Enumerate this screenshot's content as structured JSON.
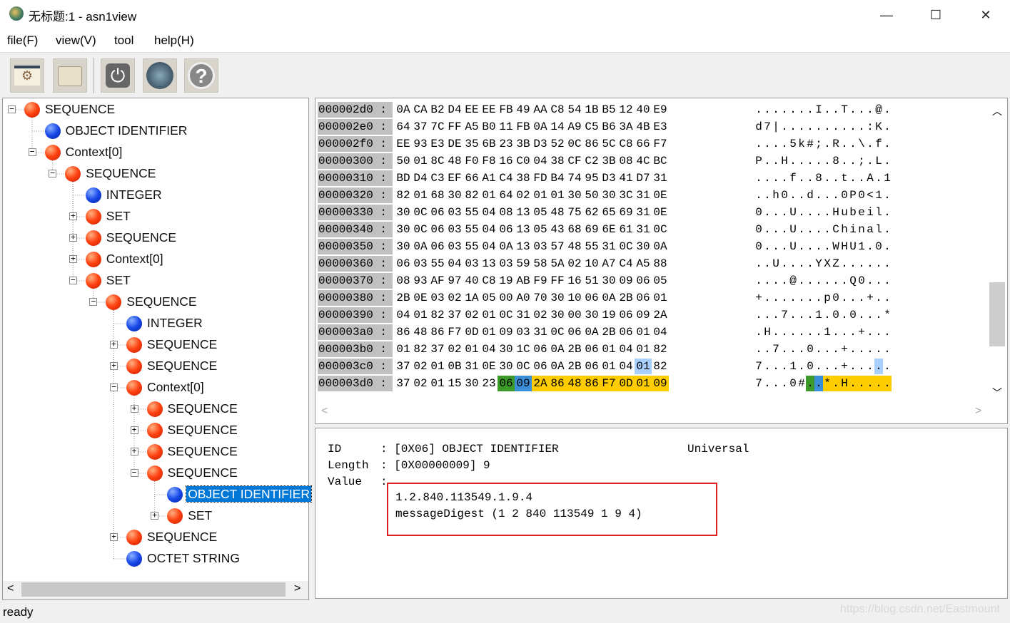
{
  "window": {
    "title": "无标题:1 - asn1view",
    "min": "—",
    "max": "☐",
    "close": "✕"
  },
  "menu": [
    "file(F)",
    "view(V)",
    "tool",
    "help(H)"
  ],
  "toolbar": [
    {
      "icon": "settings-window-icon"
    },
    {
      "icon": "folder-icon"
    },
    {
      "icon": "power-icon"
    },
    {
      "icon": "globe-image-icon"
    },
    {
      "icon": "help-icon"
    }
  ],
  "tree": [
    {
      "level": 0,
      "label": "SEQUENCE",
      "type": "red",
      "toggle": "-"
    },
    {
      "level": 1,
      "label": "OBJECT IDENTIFIER",
      "type": "blue",
      "toggle": ""
    },
    {
      "level": 1,
      "label": "Context[0]",
      "type": "red",
      "toggle": "-"
    },
    {
      "level": 2,
      "label": "SEQUENCE",
      "type": "red",
      "toggle": "-"
    },
    {
      "level": 3,
      "label": "INTEGER",
      "type": "blue",
      "toggle": ""
    },
    {
      "level": 3,
      "label": "SET",
      "type": "red",
      "toggle": "+"
    },
    {
      "level": 3,
      "label": "SEQUENCE",
      "type": "red",
      "toggle": "+"
    },
    {
      "level": 3,
      "label": "Context[0]",
      "type": "red",
      "toggle": "+"
    },
    {
      "level": 3,
      "label": "SET",
      "type": "red",
      "toggle": "-"
    },
    {
      "level": 4,
      "label": "SEQUENCE",
      "type": "red",
      "toggle": "-"
    },
    {
      "level": 5,
      "label": "INTEGER",
      "type": "blue",
      "toggle": ""
    },
    {
      "level": 5,
      "label": "SEQUENCE",
      "type": "red",
      "toggle": "+"
    },
    {
      "level": 5,
      "label": "SEQUENCE",
      "type": "red",
      "toggle": "+"
    },
    {
      "level": 5,
      "label": "Context[0]",
      "type": "red",
      "toggle": "-"
    },
    {
      "level": 6,
      "label": "SEQUENCE",
      "type": "red",
      "toggle": "+"
    },
    {
      "level": 6,
      "label": "SEQUENCE",
      "type": "red",
      "toggle": "+"
    },
    {
      "level": 6,
      "label": "SEQUENCE",
      "type": "red",
      "toggle": "+"
    },
    {
      "level": 6,
      "label": "SEQUENCE",
      "type": "red",
      "toggle": "-"
    },
    {
      "level": 7,
      "label": "OBJECT IDENTIFIER",
      "type": "blue",
      "toggle": "",
      "selected": true
    },
    {
      "level": 7,
      "label": "SET",
      "type": "red",
      "toggle": "+"
    },
    {
      "level": 5,
      "label": "SEQUENCE",
      "type": "red",
      "toggle": "+"
    },
    {
      "level": 5,
      "label": "OCTET STRING",
      "type": "blue",
      "toggle": ""
    }
  ],
  "hex": [
    {
      "off": "000002d0 :",
      "bytes": "0A CA B2 D4 EE EE FB 49 AA C8 54 1B B5 12 40 E9",
      "ascii": ".......I..T...@."
    },
    {
      "off": "000002e0 :",
      "bytes": "64 37 7C FF A5 B0 11 FB 0A 14 A9 C5 B6 3A 4B E3",
      "ascii": "d7|..........:K."
    },
    {
      "off": "000002f0 :",
      "bytes": "EE 93 E3 DE 35 6B 23 3B D3 52 0C 86 5C C8 66 F7",
      "ascii": "....5k#;.R..\\.f."
    },
    {
      "off": "00000300 :",
      "bytes": "50 01 8C 48 F0 F8 16 C0 04 38 CF C2 3B 08 4C BC",
      "ascii": "P..H.....8..;.L."
    },
    {
      "off": "00000310 :",
      "bytes": "BD D4 C3 EF 66 A1 C4 38 FD B4 74 95 D3 41 D7 31",
      "ascii": "....f..8..t..A.1"
    },
    {
      "off": "00000320 :",
      "bytes": "82 01 68 30 82 01 64 02 01 01 30 50 30 3C 31 0E",
      "ascii": "..h0..d...0P0<1."
    },
    {
      "off": "00000330 :",
      "bytes": "30 0C 06 03 55 04 08 13 05 48 75 62 65 69 31 0E",
      "ascii": "0...U....Hubeil."
    },
    {
      "off": "00000340 :",
      "bytes": "30 0C 06 03 55 04 06 13 05 43 68 69 6E 61 31 0C",
      "ascii": "0...U....Chinal."
    },
    {
      "off": "00000350 :",
      "bytes": "30 0A 06 03 55 04 0A 13 03 57 48 55 31 0C 30 0A",
      "ascii": "0...U....WHU1.0."
    },
    {
      "off": "00000360 :",
      "bytes": "06 03 55 04 03 13 03 59 58 5A 02 10 A7 C4 A5 88",
      "ascii": "..U....YXZ......"
    },
    {
      "off": "00000370 :",
      "bytes": "08 93 AF 97 40 C8 19 AB F9 FF 16 51 30 09 06 05",
      "ascii": "....@......Q0..."
    },
    {
      "off": "00000380 :",
      "bytes": "2B 0E 03 02 1A 05 00 A0 70 30 10 06 0A 2B 06 01",
      "ascii": "+.......p0...+.."
    },
    {
      "off": "00000390 :",
      "bytes": "04 01 82 37 02 01 0C 31 02 30 00 30 19 06 09 2A",
      "ascii": "...7...1.0.0...*"
    },
    {
      "off": "000003a0 :",
      "bytes": "86 48 86 F7 0D 01 09 03 31 0C 06 0A 2B 06 01 04",
      "ascii": ".H......1...+..."
    },
    {
      "off": "000003b0 :",
      "bytes": "01 82 37 02 01 04 30 1C 06 0A 2B 06 01 04 01 82",
      "ascii": "..7...0...+....."
    },
    {
      "off": "000003c0 :",
      "bytes": "37 02 01 0B 31 0E 30 0C 06 0A 2B 06 01 04 01 82",
      "ascii": "7...1.0...+.....",
      "hl": {
        "14": "light"
      }
    },
    {
      "off": "000003d0 :",
      "bytes": "37 02 01 15 30 23 06 09 2A 86 48 86 F7 0D 01 09",
      "ascii": "7...0#..*.H.....",
      "hl": {
        "6": "tag",
        "7": "len",
        "8": "val",
        "9": "val",
        "10": "val",
        "11": "val",
        "12": "val",
        "13": "val",
        "14": "val",
        "15": "val"
      }
    }
  ],
  "colors": {
    "tag": "#3c9a28",
    "len": "#3a8fd8",
    "val": "#ffcc00",
    "light": "#a8d0ff"
  },
  "detail": {
    "id_label": "ID",
    "id_value": ": [0X06] OBJECT IDENTIFIER",
    "class": "Universal",
    "length_label": "Length",
    "length_value": ": [0X00000009] 9",
    "value_label": "Value",
    "value_sep": ":",
    "value_lines": [
      "1.2.840.113549.1.9.4",
      "messageDigest (1 2 840 113549 1 9 4)"
    ]
  },
  "status": "ready",
  "watermark": "https://blog.csdn.net/Eastmount"
}
